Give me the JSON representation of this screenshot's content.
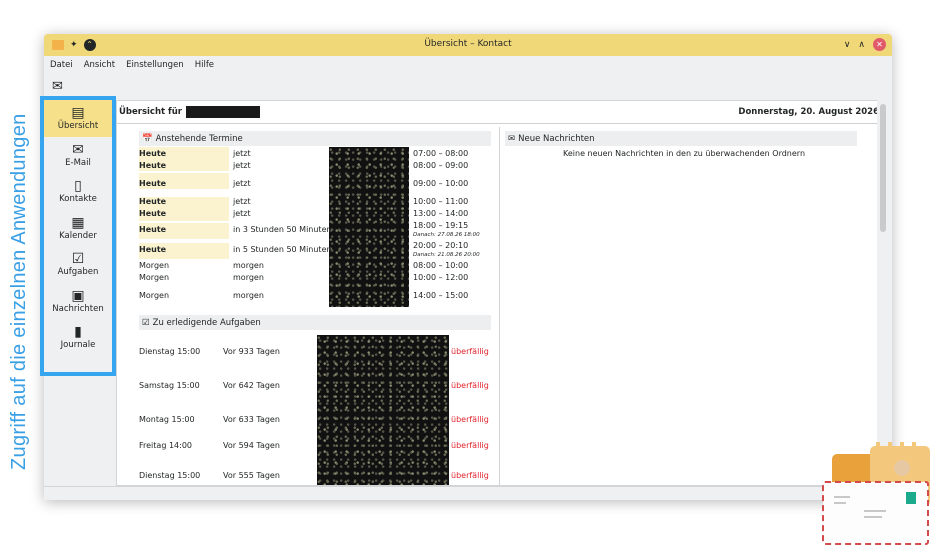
{
  "caption": "Zugriff auf die einzelnen Anwendungen",
  "window": {
    "title": "Übersicht – Kontact",
    "controls": {
      "minimize": "∨",
      "maximize": "∧",
      "close": "✕"
    }
  },
  "menubar": [
    "Datei",
    "Ansicht",
    "Einstellungen",
    "Hilfe"
  ],
  "toolbar": {
    "new_mail_icon": "envelope-plus-icon"
  },
  "sidebar": {
    "items": [
      {
        "label": "Übersicht",
        "icon": "summary-icon",
        "active": true
      },
      {
        "label": "E-Mail",
        "icon": "mail-icon"
      },
      {
        "label": "Kontakte",
        "icon": "contacts-icon"
      },
      {
        "label": "Kalender",
        "icon": "calendar-icon"
      },
      {
        "label": "Aufgaben",
        "icon": "tasks-icon"
      },
      {
        "label": "Nachrichten",
        "icon": "news-icon"
      },
      {
        "label": "Journale",
        "icon": "journal-icon"
      }
    ]
  },
  "summary": {
    "header_prefix": "Übersicht für",
    "date": "Donnerstag, 20. August 2026"
  },
  "appointments": {
    "title": "Anstehende Termine",
    "rows": [
      {
        "day": "Heute",
        "rel": "jetzt",
        "time": "07:00 – 08:00",
        "note": ""
      },
      {
        "day": "Heute",
        "rel": "jetzt",
        "time": "08:00 – 09:00",
        "note": ""
      },
      {
        "day": "Heute",
        "rel": "jetzt",
        "time": "09:00 – 10:00",
        "note": ""
      },
      {
        "day": "Heute",
        "rel": "jetzt",
        "time": "10:00 – 11:00",
        "note": ""
      },
      {
        "day": "Heute",
        "rel": "jetzt",
        "time": "13:00 – 14:00",
        "note": ""
      },
      {
        "day": "Heute",
        "rel": "in 3 Stunden 50 Minuten",
        "time": "18:00 – 19:15",
        "note": "Danach: 27.08.26 18:00"
      },
      {
        "day": "Heute",
        "rel": "in 5 Stunden 50 Minuten",
        "time": "20:00 – 20:10",
        "note": "Danach: 21.08.26 20:00"
      },
      {
        "day": "Morgen",
        "rel": "morgen",
        "time": "08:00 – 10:00",
        "note": ""
      },
      {
        "day": "Morgen",
        "rel": "morgen",
        "time": "10:00 – 12:00",
        "note": ""
      },
      {
        "day": "Morgen",
        "rel": "morgen",
        "time": "14:00 – 15:00",
        "note": ""
      }
    ]
  },
  "tasks": {
    "title": "Zu erledigende Aufgaben",
    "rows": [
      {
        "due": "Dienstag 15:00",
        "ago": "Vor 933 Tagen",
        "status": "überfällig"
      },
      {
        "due": "Samstag 15:00",
        "ago": "Vor 642 Tagen",
        "status": "überfällig"
      },
      {
        "due": "Montag 15:00",
        "ago": "Vor 633 Tagen",
        "status": "überfällig"
      },
      {
        "due": "Freitag 14:00",
        "ago": "Vor 594 Tagen",
        "status": "überfällig"
      },
      {
        "due": "Dienstag 15:00",
        "ago": "Vor 555 Tagen",
        "status": "überfällig"
      }
    ]
  },
  "messages": {
    "title": "Neue Nachrichten",
    "empty_text": "Keine neuen Nachrichten in den zu überwachenden Ordnern"
  },
  "colors": {
    "accent": "#f0d878",
    "highlight": "#35a5ef",
    "overdue": "#e0242c"
  }
}
